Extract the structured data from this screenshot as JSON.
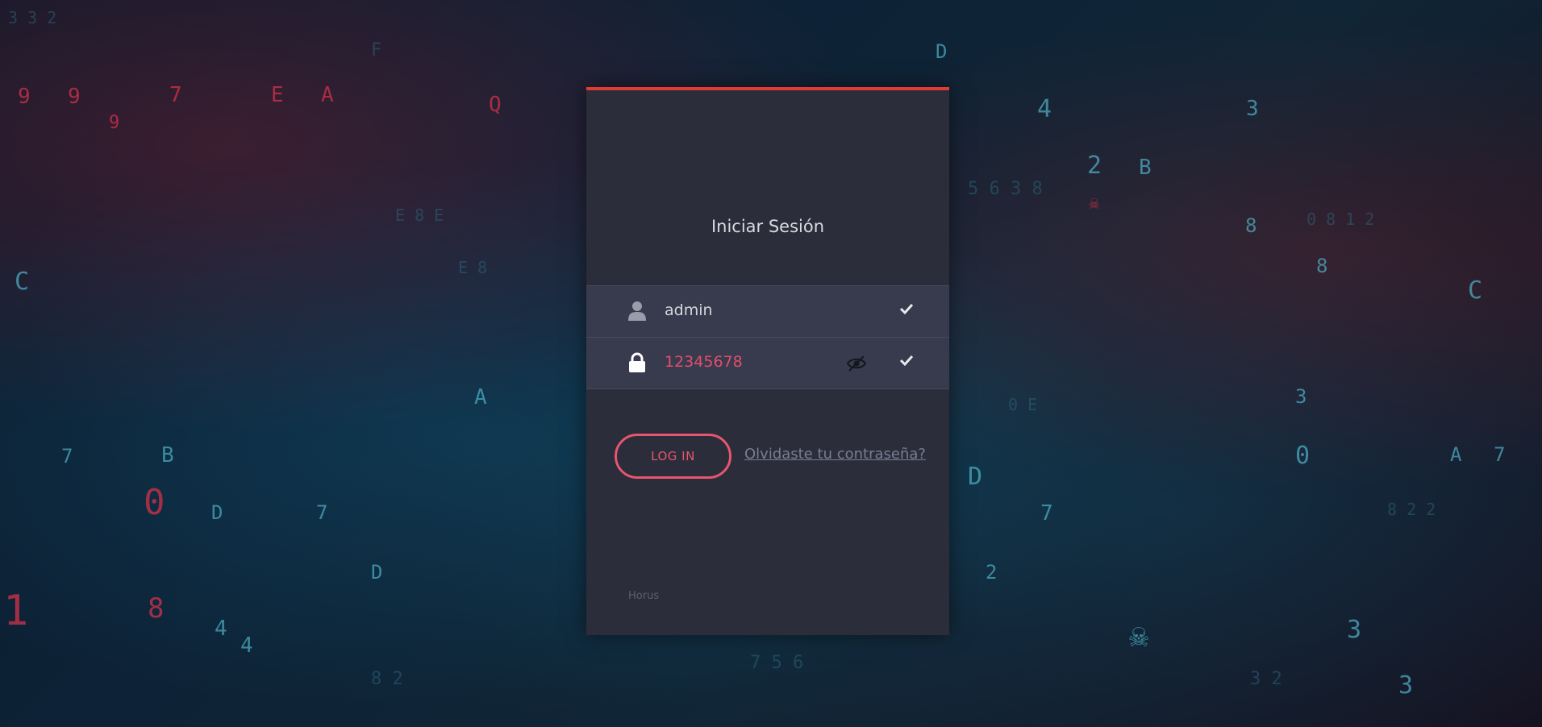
{
  "login": {
    "title": "Iniciar Sesión",
    "username": {
      "value": "admin",
      "icon": "user-icon",
      "status_icon": "check-icon"
    },
    "password": {
      "value": "12345678",
      "icon": "lock-icon",
      "toggle_icon": "eye-slash-icon",
      "status_icon": "check-icon"
    },
    "login_button": "LOG IN",
    "forgot_link": "Olvidaste tu contraseña?",
    "footer": "Horus"
  },
  "colors": {
    "accent_bar": "#e23b33",
    "button": "#e6566e",
    "password_text": "#e34d6c",
    "card_bg": "#2b2d3a",
    "field_bg": "#383b4d"
  }
}
